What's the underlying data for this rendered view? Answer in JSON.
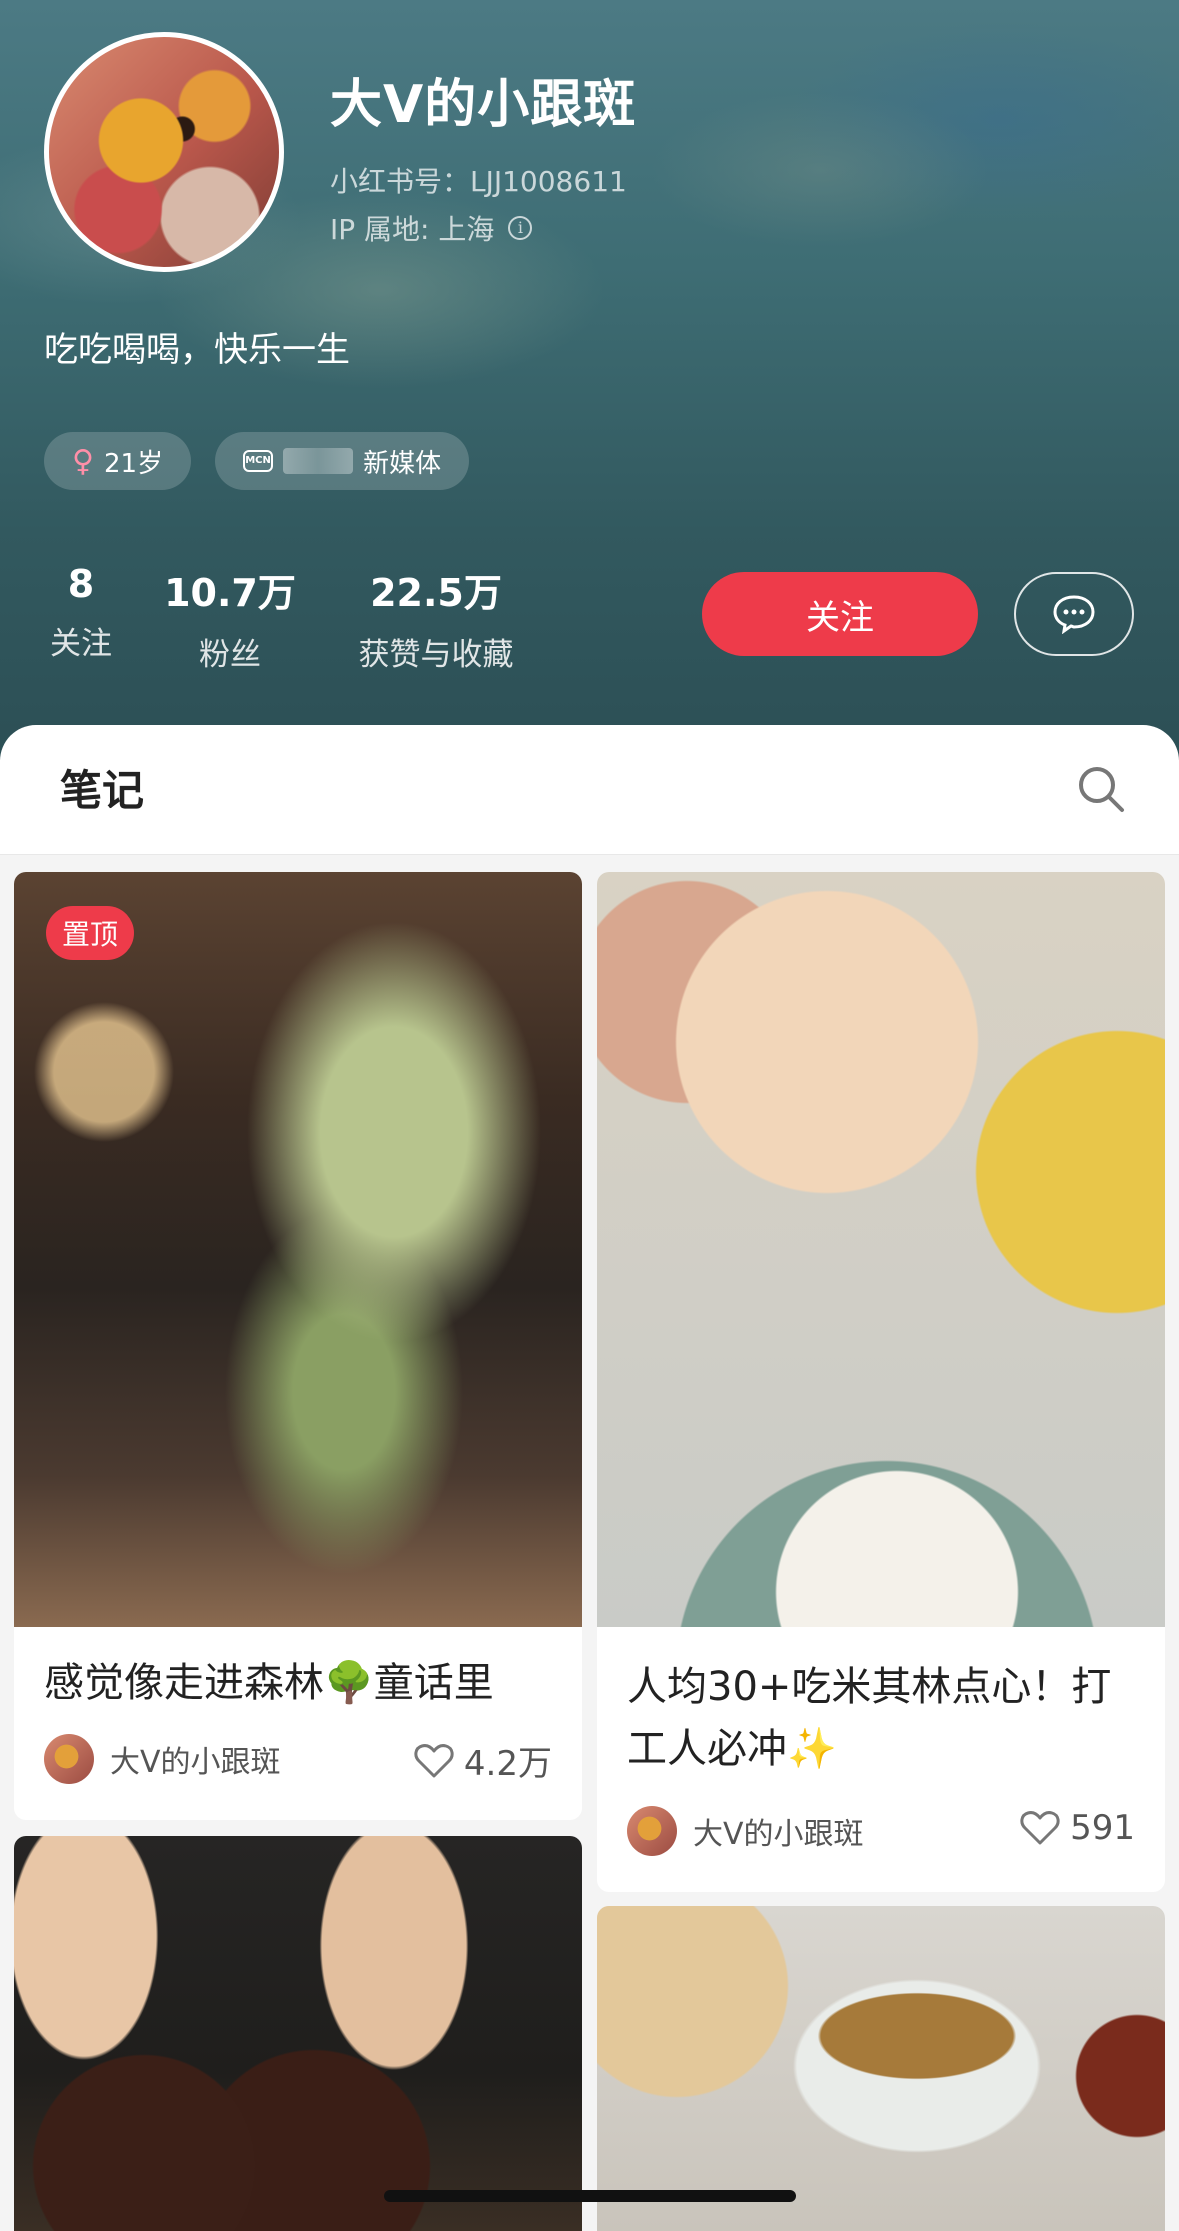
{
  "profile": {
    "nickname": "大V的小跟斑",
    "account_id": "小红书号：LJJ1008611",
    "ip_location": "IP 属地: 上海",
    "bio": "吃吃喝喝，快乐一生",
    "tags": {
      "age": "21岁",
      "org": "新媒体"
    },
    "stats": [
      {
        "value": "8",
        "label": "关注"
      },
      {
        "value": "10.7万",
        "label": "粉丝"
      },
      {
        "value": "22.5万",
        "label": "获赞与收藏"
      }
    ],
    "follow_label": "关注"
  },
  "notes_section": {
    "title": "笔记"
  },
  "notes": [
    {
      "title": "感觉像走进森林🌳童话里",
      "author": "大V的小跟斑",
      "likes": "4.2万",
      "badge": "置顶"
    },
    {
      "title": "人均30+吃米其林点心！打工人必冲✨",
      "author": "大V的小跟斑",
      "likes": "591"
    }
  ],
  "icons": {
    "info": "info-icon",
    "female": "female-icon",
    "mcn": "mcn-icon",
    "message": "chat-bubble-icon",
    "search": "search-icon",
    "heart": "heart-outline-icon"
  },
  "colors": {
    "accent": "#ee3b4a",
    "header_bg": "#3e6d74"
  }
}
